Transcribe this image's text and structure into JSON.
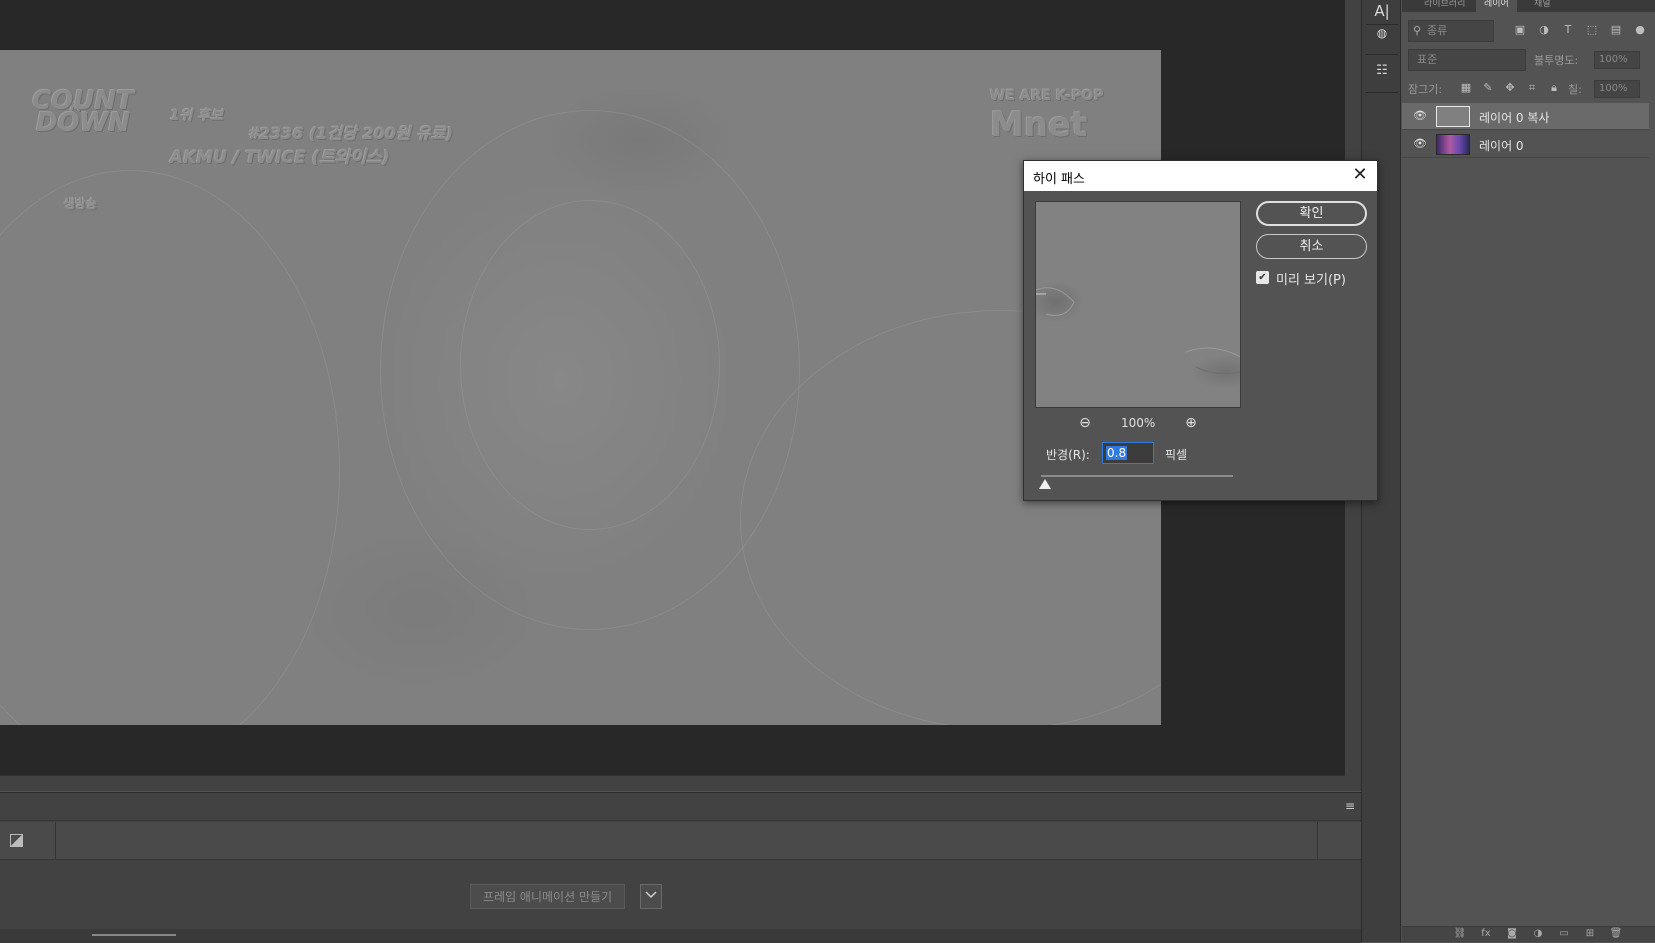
{
  "canvas": {
    "overlay": {
      "logo_line1": "COUNT",
      "logo_line2": "DOWN",
      "logo_mark": "M",
      "rank": "1위 후보",
      "episode": "#2336 (1건당 200원 유료)",
      "acts": "AKMU / TWICE (트와이스)",
      "live": "생방송",
      "tagline": "WE ARE K-POP",
      "brand": "Mnet"
    }
  },
  "timeline": {
    "menu_icon": "≡",
    "make_animation_label": "프레임 애니메이션 만들기",
    "dropdown_icon": "chevron-down-icon"
  },
  "toolstrip": {
    "icons": [
      "text-type-icon",
      "3d-icon",
      "properties-icon"
    ]
  },
  "layers_panel": {
    "tabs": [
      "라이브러리",
      "레이어",
      "채널"
    ],
    "kind_placeholder": "종류",
    "blend_mode": "표준",
    "opacity_label": "불투명도:",
    "opacity_value": "100%",
    "lock_label": "잠그기:",
    "fill_label": "칠:",
    "fill_value": "100%",
    "layers": [
      {
        "name": "레이어 0 복사",
        "selected": true,
        "thumbnail": "gray"
      },
      {
        "name": "레이어 0",
        "selected": false,
        "thumbnail": "image"
      }
    ]
  },
  "dialog": {
    "title": "하이 패스",
    "ok_label": "확인",
    "cancel_label": "취소",
    "preview_label": "미리 보기(P)",
    "preview_checked": true,
    "zoom": "100%",
    "radius_label": "반경(R):",
    "radius_value": "0.8",
    "radius_unit": "픽셀",
    "radius_slider_fraction": 0.02
  }
}
